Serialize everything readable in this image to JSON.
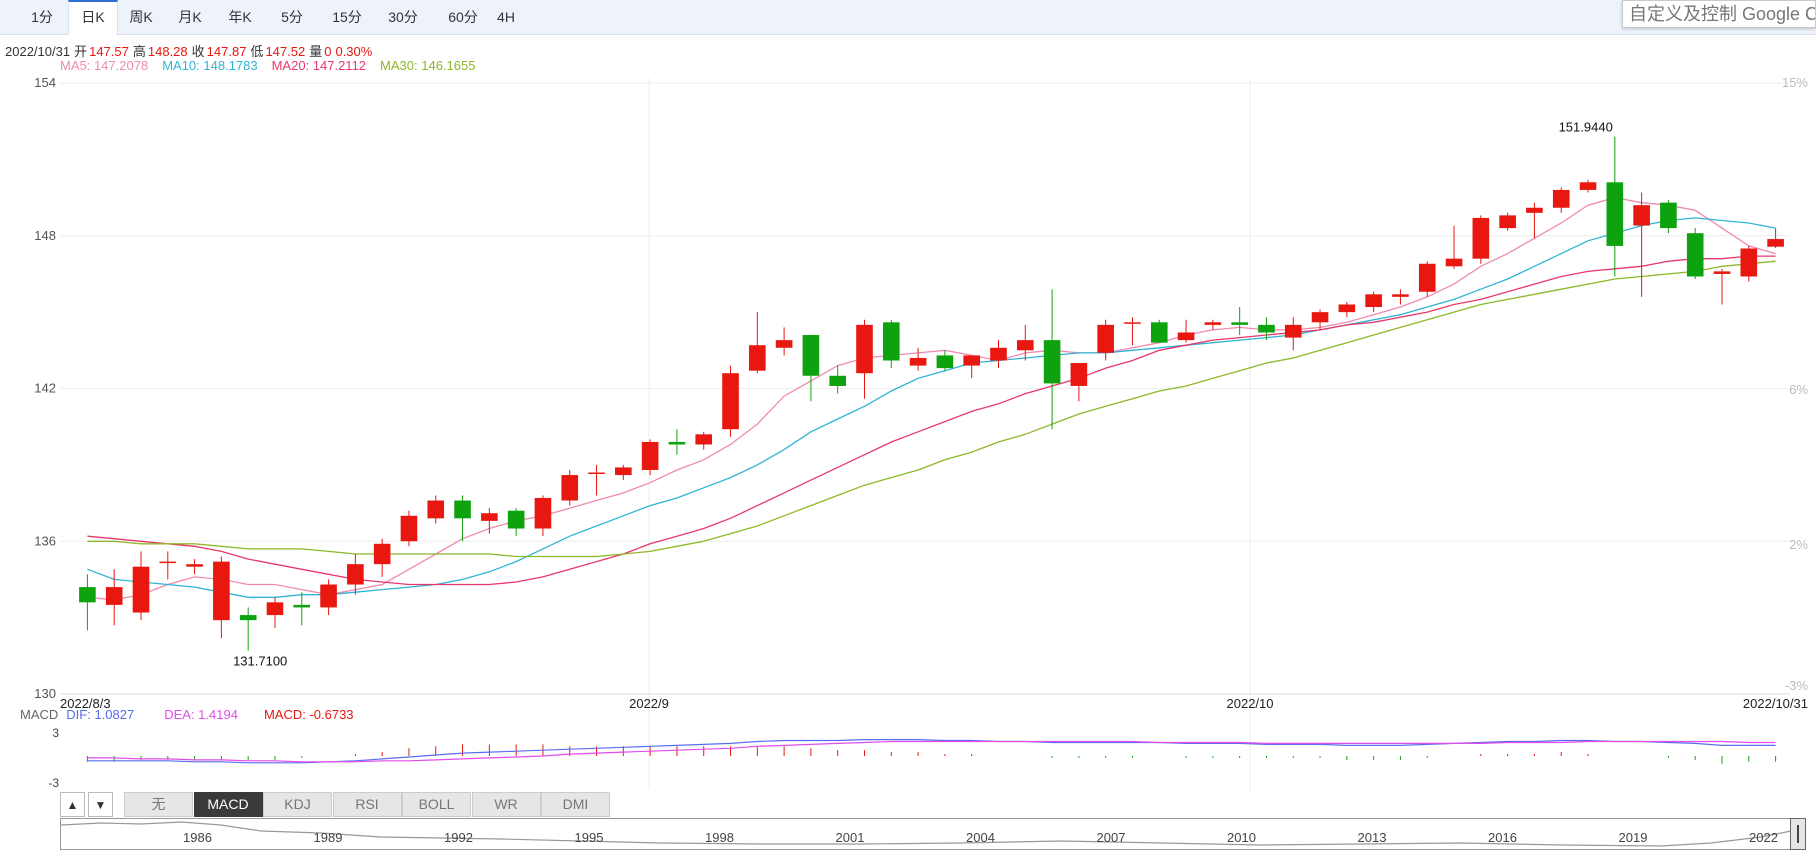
{
  "periods": [
    "1分",
    "日K",
    "周K",
    "月K",
    "年K",
    "5分",
    "15分",
    "30分",
    "60分",
    "4H"
  ],
  "active_period": "日K",
  "custom_control_label": "自定义及控制 Google C",
  "quote": {
    "date": "2022/10/31",
    "open_label": "开",
    "open": "147.57",
    "high_label": "高",
    "high": "148.28",
    "close_label": "收",
    "close": "147.87",
    "low_label": "低",
    "low": "147.52",
    "volume_label": "量",
    "volume": "0",
    "change_pct": "0.30%"
  },
  "ma_legend": [
    {
      "label": "MA5: 147.2078",
      "color": "#f08ab0"
    },
    {
      "label": "MA10: 148.1783",
      "color": "#2fb4d6"
    },
    {
      "label": "MA20: 147.2112",
      "color": "#e8386a"
    },
    {
      "label": "MA30: 146.1655",
      "color": "#8db829"
    }
  ],
  "macd_legend": {
    "name": "MACD",
    "dif": "DIF: 1.0827",
    "dif_color": "#5a6cf0",
    "dea": "DEA: 1.4194",
    "dea_color": "#e24ce8",
    "macd": "MACD: -0.6733",
    "macd_color": "#e8170f"
  },
  "indicator_tabs": [
    "无",
    "MACD",
    "KDJ",
    "RSI",
    "BOLL",
    "WR",
    "DMI"
  ],
  "active_indicator": "MACD",
  "navigator_years": [
    "1986",
    "1989",
    "1992",
    "1995",
    "1998",
    "2001",
    "2004",
    "2007",
    "2010",
    "2013",
    "2016",
    "2019",
    "2022"
  ],
  "chart_data": {
    "type": "candlestick",
    "y_ticks": [
      "154",
      "148",
      "142",
      "136",
      "130"
    ],
    "ylim": [
      130,
      154
    ],
    "pct_ticks": [
      "15%",
      "6%",
      "2%",
      "-3%"
    ],
    "x_labels": [
      "2022/8/3",
      "2022/9",
      "2022/10",
      "2022/10/31"
    ],
    "annotations": {
      "max": "151.9440",
      "min": "131.7100"
    },
    "macd_ticks": [
      "3",
      "-3"
    ],
    "candles": [
      {
        "d": "2022/8/3",
        "o": 134.2,
        "h": 134.7,
        "l": 132.5,
        "c": 133.6
      },
      {
        "d": "",
        "o": 133.5,
        "h": 134.9,
        "l": 132.7,
        "c": 134.2
      },
      {
        "d": "",
        "o": 133.2,
        "h": 135.6,
        "l": 132.9,
        "c": 135.0
      },
      {
        "d": "",
        "o": 135.2,
        "h": 135.6,
        "l": 134.5,
        "c": 135.2
      },
      {
        "d": "",
        "o": 135.0,
        "h": 135.3,
        "l": 134.7,
        "c": 135.1
      },
      {
        "d": "",
        "o": 132.9,
        "h": 135.4,
        "l": 132.2,
        "c": 135.2
      },
      {
        "d": "",
        "o": 133.1,
        "h": 133.4,
        "l": 131.7,
        "c": 132.9
      },
      {
        "d": "",
        "o": 133.1,
        "h": 133.8,
        "l": 132.6,
        "c": 133.6
      },
      {
        "d": "",
        "o": 133.5,
        "h": 134.0,
        "l": 132.7,
        "c": 133.4
      },
      {
        "d": "",
        "o": 133.4,
        "h": 134.5,
        "l": 133.1,
        "c": 134.3
      },
      {
        "d": "",
        "o": 134.3,
        "h": 135.5,
        "l": 133.9,
        "c": 135.1
      },
      {
        "d": "",
        "o": 135.1,
        "h": 136.1,
        "l": 134.6,
        "c": 135.9
      },
      {
        "d": "",
        "o": 136.0,
        "h": 137.2,
        "l": 135.8,
        "c": 137.0
      },
      {
        "d": "",
        "o": 136.9,
        "h": 137.8,
        "l": 136.7,
        "c": 137.6
      },
      {
        "d": "",
        "o": 137.6,
        "h": 137.8,
        "l": 136.0,
        "c": 136.9
      },
      {
        "d": "",
        "o": 136.8,
        "h": 137.3,
        "l": 136.3,
        "c": 137.1
      },
      {
        "d": "",
        "o": 137.2,
        "h": 137.3,
        "l": 136.2,
        "c": 136.5
      },
      {
        "d": "",
        "o": 136.5,
        "h": 137.8,
        "l": 136.2,
        "c": 137.7
      },
      {
        "d": "",
        "o": 137.6,
        "h": 138.8,
        "l": 137.4,
        "c": 138.6
      },
      {
        "d": "",
        "o": 138.7,
        "h": 139.0,
        "l": 137.8,
        "c": 138.7
      },
      {
        "d": "",
        "o": 138.6,
        "h": 139.0,
        "l": 138.4,
        "c": 138.9
      },
      {
        "d": "2022/9",
        "o": 138.8,
        "h": 140.0,
        "l": 138.6,
        "c": 139.9
      },
      {
        "d": "",
        "o": 139.9,
        "h": 140.4,
        "l": 139.4,
        "c": 139.8
      },
      {
        "d": "",
        "o": 139.8,
        "h": 140.3,
        "l": 139.6,
        "c": 140.2
      },
      {
        "d": "",
        "o": 140.4,
        "h": 142.9,
        "l": 140.1,
        "c": 142.6
      },
      {
        "d": "",
        "o": 142.7,
        "h": 145.0,
        "l": 142.6,
        "c": 143.7
      },
      {
        "d": "",
        "o": 143.6,
        "h": 144.4,
        "l": 143.3,
        "c": 143.9
      },
      {
        "d": "",
        "o": 144.1,
        "h": 144.1,
        "l": 141.5,
        "c": 142.5
      },
      {
        "d": "",
        "o": 142.5,
        "h": 142.9,
        "l": 141.8,
        "c": 142.1
      },
      {
        "d": "",
        "o": 142.6,
        "h": 144.7,
        "l": 141.6,
        "c": 144.5
      },
      {
        "d": "",
        "o": 144.6,
        "h": 144.7,
        "l": 142.8,
        "c": 143.1
      },
      {
        "d": "",
        "o": 142.9,
        "h": 143.6,
        "l": 142.7,
        "c": 143.2
      },
      {
        "d": "",
        "o": 143.3,
        "h": 143.5,
        "l": 142.7,
        "c": 142.8
      },
      {
        "d": "",
        "o": 142.9,
        "h": 143.2,
        "l": 142.4,
        "c": 143.3
      },
      {
        "d": "",
        "o": 143.1,
        "h": 143.9,
        "l": 142.8,
        "c": 143.6
      },
      {
        "d": "",
        "o": 143.5,
        "h": 144.5,
        "l": 143.1,
        "c": 143.9
      },
      {
        "d": "",
        "o": 143.9,
        "h": 145.9,
        "l": 140.4,
        "c": 142.2
      },
      {
        "d": "",
        "o": 142.1,
        "h": 143.0,
        "l": 141.5,
        "c": 143.0
      },
      {
        "d": "",
        "o": 143.4,
        "h": 144.7,
        "l": 143.1,
        "c": 144.5
      },
      {
        "d": "2022/10",
        "o": 144.6,
        "h": 144.8,
        "l": 143.7,
        "c": 144.6
      },
      {
        "d": "",
        "o": 144.6,
        "h": 144.7,
        "l": 143.8,
        "c": 143.8
      },
      {
        "d": "",
        "o": 143.9,
        "h": 144.7,
        "l": 143.8,
        "c": 144.2
      },
      {
        "d": "",
        "o": 144.5,
        "h": 144.7,
        "l": 144.3,
        "c": 144.6
      },
      {
        "d": "",
        "o": 144.6,
        "h": 145.2,
        "l": 144.1,
        "c": 144.5
      },
      {
        "d": "",
        "o": 144.5,
        "h": 144.8,
        "l": 143.9,
        "c": 144.2
      },
      {
        "d": "",
        "o": 144.0,
        "h": 144.8,
        "l": 143.5,
        "c": 144.5
      },
      {
        "d": "",
        "o": 144.6,
        "h": 145.1,
        "l": 144.3,
        "c": 145.0
      },
      {
        "d": "",
        "o": 145.0,
        "h": 145.4,
        "l": 144.8,
        "c": 145.3
      },
      {
        "d": "",
        "o": 145.2,
        "h": 145.8,
        "l": 145.0,
        "c": 145.7
      },
      {
        "d": "",
        "o": 145.6,
        "h": 145.9,
        "l": 145.3,
        "c": 145.7
      },
      {
        "d": "",
        "o": 145.8,
        "h": 147.0,
        "l": 145.6,
        "c": 146.9
      },
      {
        "d": "",
        "o": 146.8,
        "h": 148.4,
        "l": 146.7,
        "c": 147.1
      },
      {
        "d": "",
        "o": 147.1,
        "h": 148.8,
        "l": 146.9,
        "c": 148.7
      },
      {
        "d": "",
        "o": 148.3,
        "h": 148.9,
        "l": 148.2,
        "c": 148.8
      },
      {
        "d": "",
        "o": 148.9,
        "h": 149.3,
        "l": 147.9,
        "c": 149.1
      },
      {
        "d": "",
        "o": 149.1,
        "h": 149.9,
        "l": 148.9,
        "c": 149.8
      },
      {
        "d": "",
        "o": 149.8,
        "h": 150.2,
        "l": 149.7,
        "c": 150.1
      },
      {
        "d": "",
        "o": 150.1,
        "h": 151.9,
        "l": 146.4,
        "c": 147.6
      },
      {
        "d": "",
        "o": 148.4,
        "h": 149.7,
        "l": 145.6,
        "c": 149.2
      },
      {
        "d": "",
        "o": 149.3,
        "h": 149.4,
        "l": 148.1,
        "c": 148.3
      },
      {
        "d": "",
        "o": 148.1,
        "h": 148.3,
        "l": 146.3,
        "c": 146.4
      },
      {
        "d": "",
        "o": 146.5,
        "h": 146.7,
        "l": 145.3,
        "c": 146.6
      },
      {
        "d": "",
        "o": 146.4,
        "h": 147.6,
        "l": 146.2,
        "c": 147.5
      },
      {
        "d": "2022/10/31",
        "o": 147.57,
        "h": 148.28,
        "l": 147.52,
        "c": 147.87
      }
    ],
    "ma5": [
      133.8,
      133.7,
      133.9,
      134.3,
      134.6,
      134.5,
      134.3,
      134.3,
      134.1,
      133.9,
      134.1,
      134.3,
      134.9,
      135.5,
      136.1,
      136.5,
      136.8,
      137.0,
      137.3,
      137.6,
      137.9,
      138.3,
      138.8,
      139.2,
      139.8,
      140.6,
      141.7,
      142.3,
      142.9,
      143.2,
      143.3,
      143.4,
      143.5,
      143.3,
      143.1,
      143.4,
      143.5,
      143.4,
      143.4,
      143.6,
      143.8,
      144.1,
      144.3,
      144.4,
      144.3,
      144.3,
      144.4,
      144.6,
      144.9,
      145.2,
      145.6,
      146.1,
      146.8,
      147.3,
      147.9,
      148.5,
      149.2,
      149.5,
      149.3,
      149.2,
      149.0,
      148.3,
      147.6,
      147.3
    ],
    "ma10": [
      134.9,
      134.5,
      134.4,
      134.3,
      134.2,
      134.0,
      133.8,
      133.8,
      133.9,
      133.9,
      134.0,
      134.1,
      134.2,
      134.3,
      134.5,
      134.8,
      135.2,
      135.7,
      136.2,
      136.6,
      137.0,
      137.4,
      137.7,
      138.1,
      138.5,
      139.0,
      139.6,
      140.3,
      140.8,
      141.3,
      141.9,
      142.4,
      142.7,
      143.0,
      143.1,
      143.2,
      143.3,
      143.4,
      143.4,
      143.5,
      143.6,
      143.7,
      143.8,
      143.9,
      144.0,
      144.1,
      144.3,
      144.5,
      144.7,
      144.9,
      145.2,
      145.5,
      145.9,
      146.3,
      146.8,
      147.3,
      147.8,
      148.1,
      148.4,
      148.6,
      148.7,
      148.6,
      148.5,
      148.3
    ],
    "ma20": [
      136.2,
      136.1,
      136.0,
      135.9,
      135.8,
      135.6,
      135.3,
      135.1,
      134.9,
      134.7,
      134.5,
      134.4,
      134.3,
      134.3,
      134.3,
      134.3,
      134.4,
      134.6,
      134.9,
      135.2,
      135.5,
      135.9,
      136.2,
      136.5,
      136.9,
      137.4,
      137.9,
      138.4,
      138.9,
      139.4,
      139.9,
      140.3,
      140.7,
      141.1,
      141.4,
      141.8,
      142.1,
      142.4,
      142.8,
      143.1,
      143.5,
      143.7,
      143.9,
      144.0,
      144.1,
      144.2,
      144.3,
      144.5,
      144.6,
      144.8,
      145.0,
      145.3,
      145.5,
      145.8,
      146.1,
      146.4,
      146.6,
      146.7,
      146.8,
      147.0,
      147.1,
      147.1,
      147.2,
      147.2
    ],
    "ma30": [
      136.0,
      136.0,
      135.9,
      135.9,
      135.9,
      135.8,
      135.7,
      135.7,
      135.7,
      135.6,
      135.5,
      135.5,
      135.5,
      135.5,
      135.5,
      135.5,
      135.4,
      135.4,
      135.4,
      135.4,
      135.5,
      135.6,
      135.8,
      136.0,
      136.3,
      136.6,
      137.0,
      137.4,
      137.8,
      138.2,
      138.5,
      138.8,
      139.2,
      139.5,
      139.9,
      140.2,
      140.6,
      141.0,
      141.3,
      141.6,
      141.9,
      142.1,
      142.4,
      142.7,
      143.0,
      143.2,
      143.5,
      143.8,
      144.1,
      144.4,
      144.7,
      145.0,
      145.3,
      145.5,
      145.7,
      145.9,
      146.1,
      146.3,
      146.4,
      146.5,
      146.6,
      146.8,
      146.9,
      147.0
    ],
    "dif": [
      -0.5,
      -0.5,
      -0.5,
      -0.5,
      -0.6,
      -0.6,
      -0.7,
      -0.7,
      -0.7,
      -0.6,
      -0.5,
      -0.3,
      -0.1,
      0.1,
      0.3,
      0.4,
      0.5,
      0.6,
      0.7,
      0.8,
      0.9,
      1.0,
      1.1,
      1.2,
      1.3,
      1.5,
      1.6,
      1.6,
      1.6,
      1.7,
      1.7,
      1.7,
      1.6,
      1.6,
      1.5,
      1.5,
      1.4,
      1.4,
      1.4,
      1.4,
      1.4,
      1.3,
      1.3,
      1.3,
      1.2,
      1.2,
      1.2,
      1.1,
      1.1,
      1.1,
      1.2,
      1.3,
      1.4,
      1.5,
      1.5,
      1.6,
      1.6,
      1.5,
      1.5,
      1.4,
      1.3,
      1.1,
      1.1,
      1.1
    ],
    "dea": [
      -0.2,
      -0.2,
      -0.3,
      -0.3,
      -0.4,
      -0.4,
      -0.5,
      -0.5,
      -0.6,
      -0.6,
      -0.6,
      -0.5,
      -0.5,
      -0.4,
      -0.3,
      -0.2,
      -0.1,
      0.0,
      0.2,
      0.3,
      0.4,
      0.5,
      0.6,
      0.7,
      0.8,
      1.0,
      1.1,
      1.2,
      1.3,
      1.4,
      1.5,
      1.5,
      1.5,
      1.5,
      1.5,
      1.5,
      1.5,
      1.5,
      1.5,
      1.5,
      1.4,
      1.4,
      1.4,
      1.4,
      1.3,
      1.3,
      1.3,
      1.3,
      1.3,
      1.3,
      1.3,
      1.3,
      1.3,
      1.4,
      1.4,
      1.4,
      1.5,
      1.5,
      1.5,
      1.5,
      1.5,
      1.5,
      1.4,
      1.4
    ]
  }
}
